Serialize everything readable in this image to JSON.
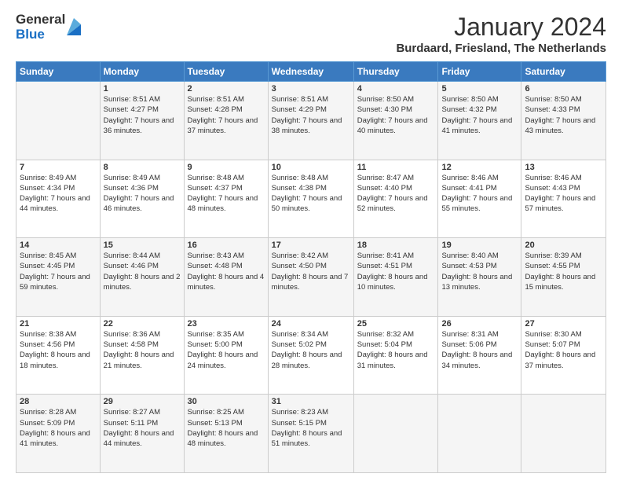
{
  "logo": {
    "general": "General",
    "blue": "Blue"
  },
  "header": {
    "month": "January 2024",
    "location": "Burdaard, Friesland, The Netherlands"
  },
  "weekdays": [
    "Sunday",
    "Monday",
    "Tuesday",
    "Wednesday",
    "Thursday",
    "Friday",
    "Saturday"
  ],
  "weeks": [
    [
      {
        "day": "",
        "sunrise": "",
        "sunset": "",
        "daylight": ""
      },
      {
        "day": "1",
        "sunrise": "Sunrise: 8:51 AM",
        "sunset": "Sunset: 4:27 PM",
        "daylight": "Daylight: 7 hours and 36 minutes."
      },
      {
        "day": "2",
        "sunrise": "Sunrise: 8:51 AM",
        "sunset": "Sunset: 4:28 PM",
        "daylight": "Daylight: 7 hours and 37 minutes."
      },
      {
        "day": "3",
        "sunrise": "Sunrise: 8:51 AM",
        "sunset": "Sunset: 4:29 PM",
        "daylight": "Daylight: 7 hours and 38 minutes."
      },
      {
        "day": "4",
        "sunrise": "Sunrise: 8:50 AM",
        "sunset": "Sunset: 4:30 PM",
        "daylight": "Daylight: 7 hours and 40 minutes."
      },
      {
        "day": "5",
        "sunrise": "Sunrise: 8:50 AM",
        "sunset": "Sunset: 4:32 PM",
        "daylight": "Daylight: 7 hours and 41 minutes."
      },
      {
        "day": "6",
        "sunrise": "Sunrise: 8:50 AM",
        "sunset": "Sunset: 4:33 PM",
        "daylight": "Daylight: 7 hours and 43 minutes."
      }
    ],
    [
      {
        "day": "7",
        "sunrise": "Sunrise: 8:49 AM",
        "sunset": "Sunset: 4:34 PM",
        "daylight": "Daylight: 7 hours and 44 minutes."
      },
      {
        "day": "8",
        "sunrise": "Sunrise: 8:49 AM",
        "sunset": "Sunset: 4:36 PM",
        "daylight": "Daylight: 7 hours and 46 minutes."
      },
      {
        "day": "9",
        "sunrise": "Sunrise: 8:48 AM",
        "sunset": "Sunset: 4:37 PM",
        "daylight": "Daylight: 7 hours and 48 minutes."
      },
      {
        "day": "10",
        "sunrise": "Sunrise: 8:48 AM",
        "sunset": "Sunset: 4:38 PM",
        "daylight": "Daylight: 7 hours and 50 minutes."
      },
      {
        "day": "11",
        "sunrise": "Sunrise: 8:47 AM",
        "sunset": "Sunset: 4:40 PM",
        "daylight": "Daylight: 7 hours and 52 minutes."
      },
      {
        "day": "12",
        "sunrise": "Sunrise: 8:46 AM",
        "sunset": "Sunset: 4:41 PM",
        "daylight": "Daylight: 7 hours and 55 minutes."
      },
      {
        "day": "13",
        "sunrise": "Sunrise: 8:46 AM",
        "sunset": "Sunset: 4:43 PM",
        "daylight": "Daylight: 7 hours and 57 minutes."
      }
    ],
    [
      {
        "day": "14",
        "sunrise": "Sunrise: 8:45 AM",
        "sunset": "Sunset: 4:45 PM",
        "daylight": "Daylight: 7 hours and 59 minutes."
      },
      {
        "day": "15",
        "sunrise": "Sunrise: 8:44 AM",
        "sunset": "Sunset: 4:46 PM",
        "daylight": "Daylight: 8 hours and 2 minutes."
      },
      {
        "day": "16",
        "sunrise": "Sunrise: 8:43 AM",
        "sunset": "Sunset: 4:48 PM",
        "daylight": "Daylight: 8 hours and 4 minutes."
      },
      {
        "day": "17",
        "sunrise": "Sunrise: 8:42 AM",
        "sunset": "Sunset: 4:50 PM",
        "daylight": "Daylight: 8 hours and 7 minutes."
      },
      {
        "day": "18",
        "sunrise": "Sunrise: 8:41 AM",
        "sunset": "Sunset: 4:51 PM",
        "daylight": "Daylight: 8 hours and 10 minutes."
      },
      {
        "day": "19",
        "sunrise": "Sunrise: 8:40 AM",
        "sunset": "Sunset: 4:53 PM",
        "daylight": "Daylight: 8 hours and 13 minutes."
      },
      {
        "day": "20",
        "sunrise": "Sunrise: 8:39 AM",
        "sunset": "Sunset: 4:55 PM",
        "daylight": "Daylight: 8 hours and 15 minutes."
      }
    ],
    [
      {
        "day": "21",
        "sunrise": "Sunrise: 8:38 AM",
        "sunset": "Sunset: 4:56 PM",
        "daylight": "Daylight: 8 hours and 18 minutes."
      },
      {
        "day": "22",
        "sunrise": "Sunrise: 8:36 AM",
        "sunset": "Sunset: 4:58 PM",
        "daylight": "Daylight: 8 hours and 21 minutes."
      },
      {
        "day": "23",
        "sunrise": "Sunrise: 8:35 AM",
        "sunset": "Sunset: 5:00 PM",
        "daylight": "Daylight: 8 hours and 24 minutes."
      },
      {
        "day": "24",
        "sunrise": "Sunrise: 8:34 AM",
        "sunset": "Sunset: 5:02 PM",
        "daylight": "Daylight: 8 hours and 28 minutes."
      },
      {
        "day": "25",
        "sunrise": "Sunrise: 8:32 AM",
        "sunset": "Sunset: 5:04 PM",
        "daylight": "Daylight: 8 hours and 31 minutes."
      },
      {
        "day": "26",
        "sunrise": "Sunrise: 8:31 AM",
        "sunset": "Sunset: 5:06 PM",
        "daylight": "Daylight: 8 hours and 34 minutes."
      },
      {
        "day": "27",
        "sunrise": "Sunrise: 8:30 AM",
        "sunset": "Sunset: 5:07 PM",
        "daylight": "Daylight: 8 hours and 37 minutes."
      }
    ],
    [
      {
        "day": "28",
        "sunrise": "Sunrise: 8:28 AM",
        "sunset": "Sunset: 5:09 PM",
        "daylight": "Daylight: 8 hours and 41 minutes."
      },
      {
        "day": "29",
        "sunrise": "Sunrise: 8:27 AM",
        "sunset": "Sunset: 5:11 PM",
        "daylight": "Daylight: 8 hours and 44 minutes."
      },
      {
        "day": "30",
        "sunrise": "Sunrise: 8:25 AM",
        "sunset": "Sunset: 5:13 PM",
        "daylight": "Daylight: 8 hours and 48 minutes."
      },
      {
        "day": "31",
        "sunrise": "Sunrise: 8:23 AM",
        "sunset": "Sunset: 5:15 PM",
        "daylight": "Daylight: 8 hours and 51 minutes."
      },
      {
        "day": "",
        "sunrise": "",
        "sunset": "",
        "daylight": ""
      },
      {
        "day": "",
        "sunrise": "",
        "sunset": "",
        "daylight": ""
      },
      {
        "day": "",
        "sunrise": "",
        "sunset": "",
        "daylight": ""
      }
    ]
  ]
}
